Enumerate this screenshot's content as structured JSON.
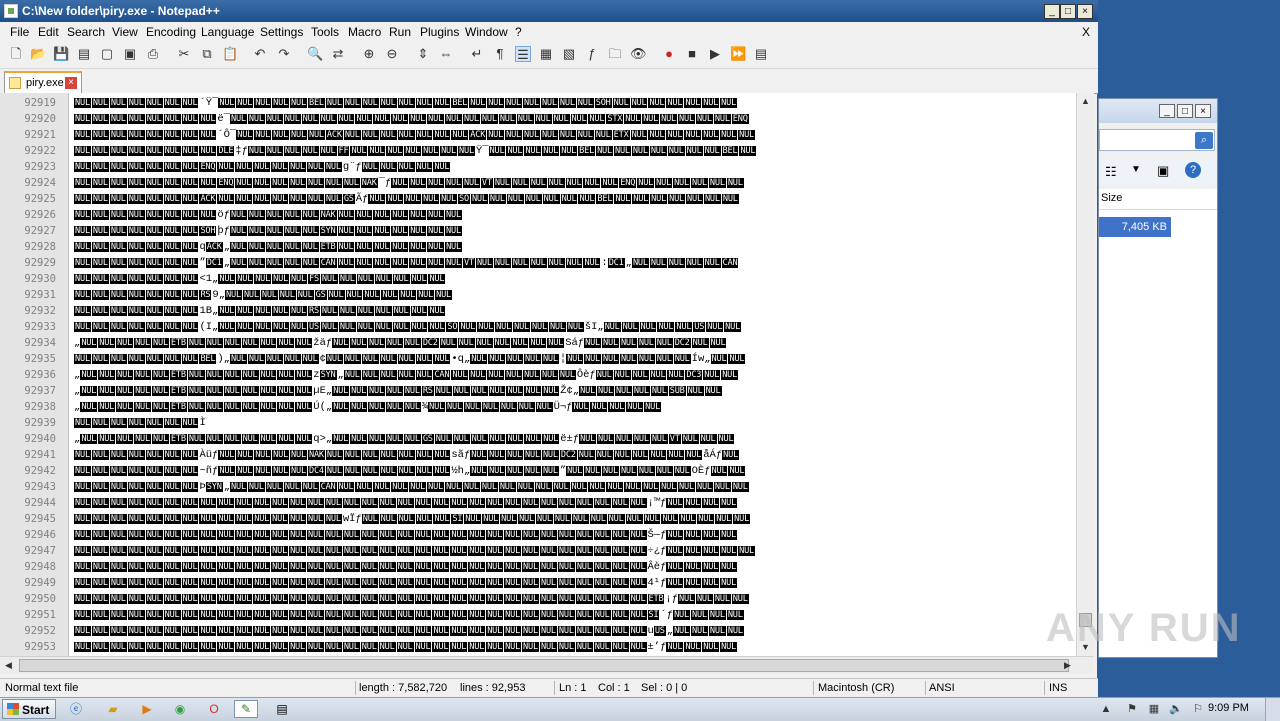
{
  "window": {
    "title": "C:\\New folder\\piry.exe - Notepad++",
    "mdi_close": "X"
  },
  "menu": [
    "File",
    "Edit",
    "Search",
    "View",
    "Encoding",
    "Language",
    "Settings",
    "Tools",
    "Macro",
    "Run",
    "Plugins",
    "Window",
    "?"
  ],
  "tab": {
    "label": "piry.exe"
  },
  "editor": {
    "lines": [
      {
        "n": "92919",
        "t": "NUL NUL NUL NUL NUL NUL NUL ´Ÿ¯ NUL NUL NUL NUL NUL BEL NUL NUL NUL NUL NUL NUL NUL BEL NUL NUL NUL NUL NUL NUL NUL SOH NUL NUL NUL NUL NUL NUL NUL"
      },
      {
        "n": "92920",
        "t": "NUL NUL NUL NUL NUL NUL NUL NUL ë¯ NUL NUL NUL NUL NUL NUL  NUL NUL NUL NUL NUL NUL NUL NUL NUL NUL NUL NUL NUL NUL NUL STX NUL NUL NUL NUL NUL NUL ENQ"
      },
      {
        "n": "92921",
        "t": "NUL NUL NUL NUL NUL NUL NUL NUL ´Ô¯ NUL NUL NUL NUL NUL ACK NUL NUL NUL NUL NUL NUL NUL ACK NUL NUL NUL NUL NUL NUL NUL ETX NUL NUL NUL NUL NUL NUL NUL"
      },
      {
        "n": "92922",
        "t": "NUL NUL NUL NUL NUL NUL NUL NUL DLE ‡ƒ NUL NUL NUL NUL NUL FF NUL NUL NUL NUL NUL NUL NUL  Ÿ¯ NUL NUL NUL NUL NUL BEL NUL NUL NUL NUL NUL NUL NUL BEL NUL"
      },
      {
        "n": "92923",
        "t": "NUL NUL NUL NUL NUL NUL NUL ENQ NUL NUL NUL NUL NUL NUL NUL g¨ƒ NUL NUL NUL NUL NUL"
      },
      {
        "n": "92924",
        "t": "NUL NUL NUL NUL NUL NUL NUL NUL ENQ NUL NUL NUL NUL NUL NUL NUL NAK¯ƒ NUL NUL NUL NUL NUL VT NUL NUL NUL NUL NUL NUL NUL ENQ NUL NUL NUL NUL NUL NUL"
      },
      {
        "n": "92925",
        "t": "NUL NUL NUL NUL NUL NUL NUL ACK NUL NUL NUL NUL NUL NUL NUL GS Ãƒ NUL NUL NUL NUL NUL SO NUL NUL NUL NUL NUL NUL NUL BEL NUL NUL NUL NUL NUL NUL NUL"
      },
      {
        "n": "92926",
        "t": "NUL NUL NUL NUL NUL NUL NUL NUL öƒ NUL NUL NUL NUL NUL NAK NUL NUL NUL NUL NUL NUL NUL"
      },
      {
        "n": "92927",
        "t": "NUL NUL NUL NUL NUL NUL NUL SOH þƒ NUL NUL NUL NUL NUL SYN NUL NUL NUL NUL NUL NUL NUL"
      },
      {
        "n": "92928",
        "t": "NUL NUL NUL NUL NUL NUL NUL qACK„ NUL NUL NUL NUL NUL ETB NUL NUL NUL NUL NUL NUL NUL"
      },
      {
        "n": "92929",
        "t": "NUL NUL NUL NUL NUL NUL NUL ”DC1„ NUL NUL NUL NUL NUL CAN NUL NUL NUL NUL NUL NUL NUL VT NUL NUL NUL NUL NUL NUL NUL :DC1„ NUL NUL NUL NUL NUL CAN"
      },
      {
        "n": "92930",
        "t": "NUL NUL NUL NUL NUL NUL NUL <1„ NUL NUL NUL NUL NUL FS NUL NUL NUL NUL NUL NUL NUL"
      },
      {
        "n": "92931",
        "t": "NUL NUL NUL NUL NUL NUL NUL RS9„ NUL NUL NUL NUL NUL GS NUL NUL NUL NUL NUL NUL NUL"
      },
      {
        "n": "92932",
        "t": "NUL NUL NUL NUL NUL NUL NUL 1B„ NUL NUL NUL NUL NUL RS NUL NUL NUL NUL NUL NUL NUL"
      },
      {
        "n": "92933",
        "t": "NUL NUL NUL NUL NUL NUL NUL (I„ NUL NUL NUL NUL NUL US NUL NUL NUL NUL NUL NUL NUL SO NUL NUL NUL NUL NUL NUL NUL šI„ NUL NUL NUL NUL NUL US NUL NUL"
      },
      {
        "n": "92934",
        "t": "„ NUL NUL NUL NUL NUL ETB NUL NUL NUL NUL NUL NUL NUL žäƒ NUL NUL NUL NUL NUL DC2 NUL NUL NUL NUL NUL NUL NUL Sáƒ NUL NUL NUL NUL NUL DC2 NUL NUL"
      },
      {
        "n": "92935",
        "t": "NUL NUL NUL NUL NUL NUL NUL BEL) „ NUL NUL NUL NUL NUL ¢ NUL NUL NUL NUL NUL NUL NUL •q„ NUL NUL NUL NUL NUL ¦ NUL NUL NUL NUL NUL NUL NUL Íw„ NUL NUL"
      },
      {
        "n": "92936",
        "t": "„ NUL NUL NUL NUL NUL ETB NUL NUL NUL NUL NUL NUL NUL zSYN„ NUL NUL NUL NUL NUL CAN NUL NUL NUL NUL NUL NUL NUL Ôèƒ NUL NUL NUL NUL NUL DC3 NUL NUL"
      },
      {
        "n": "92937",
        "t": "„ NUL NUL NUL NUL NUL ETB NUL NUL NUL NUL NUL NUL NUL µE„ NUL NUL NUL NUL NUL RS NUL NUL NUL NUL NUL NUL NUL Ž¢„ NUL NUL NUL NUL NUL SUB NUL NUL"
      },
      {
        "n": "92938",
        "t": "„ NUL NUL NUL NUL NUL ETB NUL NUL NUL NUL NUL NUL NUL Ú(„ NUL NUL NUL NUL NUL ¾ NUL NUL NUL NUL NUL NUL NUL Ü¬ƒ NUL NUL NUL NUL NUL"
      },
      {
        "n": "92939",
        "t": "NUL NUL NUL NUL NUL NUL NUL Ì"
      },
      {
        "n": "92940",
        "t": "„ NUL NUL NUL NUL NUL ETB NUL NUL NUL NUL NUL NUL NUL q>„ NUL NUL NUL NUL NUL GS NUL NUL NUL NUL NUL NUL NUL ë±ƒ NUL NUL NUL NUL NUL VT NUL NUL NUL"
      },
      {
        "n": "92941",
        "t": "NUL NUL NUL NUL NUL NUL NUL Àüƒ NUL NUL NUL NUL NUL NAK NUL NUL NUL NUL NUL NUL NUL sãƒ NUL NUL NUL NUL NUL DC2 NUL NUL NUL NUL NUL NUL NUL åÁƒ NUL"
      },
      {
        "n": "92942",
        "t": "NUL NUL NUL NUL NUL NUL NUL ~ñƒ NUL NUL NUL NUL NUL DC4 NUL NUL NUL NUL NUL NUL NUL ½h„ NUL NUL NUL NUL NUL ” NUL NUL NUL NUL NUL NUL NUL OÈƒ NUL NUL"
      },
      {
        "n": "92943",
        "t": "NUL NUL NUL NUL NUL NUL NUL Þ SYN„ NUL NUL NUL NUL NUL CAN NUL NUL NUL NUL NUL NUL NUL NUL NUL NUL NUL NUL NUL NUL NUL NUL NUL NUL NUL NUL NUL NUL NUL"
      },
      {
        "n": "92944",
        "t": "NUL NUL NUL NUL NUL NUL NUL NUL NUL NUL NUL NUL NUL NUL NUL NUL NUL NUL NUL NUL NUL NUL NUL NUL NUL NUL NUL NUL NUL NUL NUL NUL ¡™ƒ NUL NUL NUL NUL"
      },
      {
        "n": "92945",
        "t": "NUL NUL NUL NUL NUL NUL NUL NUL NUL NUL NUL NUL NUL NUL NUL wÏƒ NUL NUL NUL NUL NUL SI NUL NUL NUL NUL NUL NUL NUL NUL NUL NUL NUL NUL NUL NUL NUL NUL"
      },
      {
        "n": "92946",
        "t": "NUL NUL NUL NUL NUL NUL NUL NUL NUL NUL NUL NUL NUL NUL NUL NUL NUL NUL NUL NUL NUL NUL NUL NUL NUL NUL NUL NUL NUL NUL NUL NUL Š—ƒ NUL NUL NUL NUL"
      },
      {
        "n": "92947",
        "t": "NUL NUL NUL NUL NUL NUL NUL NUL NUL NUL NUL NUL NUL NUL NUL NUL NUL NUL NUL NUL NUL NUL NUL NUL NUL NUL NUL NUL NUL NUL NUL NUL ÷¿ƒ NUL NUL NUL NUL NUL"
      },
      {
        "n": "92948",
        "t": "NUL NUL NUL NUL NUL NUL NUL NUL NUL NUL NUL NUL NUL NUL NUL NUL NUL NUL NUL NUL NUL NUL NUL NUL NUL NUL NUL NUL NUL NUL NUL NUL Âèƒ NUL NUL NUL NUL"
      },
      {
        "n": "92949",
        "t": "NUL NUL NUL NUL NUL NUL NUL NUL NUL NUL NUL NUL NUL NUL NUL NUL NUL NUL NUL NUL NUL NUL NUL NUL NUL NUL NUL NUL NUL NUL NUL NUL 4¹ƒ NUL NUL NUL NUL"
      },
      {
        "n": "92950",
        "t": "NUL NUL NUL NUL NUL NUL NUL NUL NUL NUL NUL NUL NUL NUL NUL NUL NUL NUL NUL NUL NUL NUL NUL NUL NUL NUL NUL NUL NUL NUL NUL NUL ETB¡ƒ NUL NUL NUL NUL"
      },
      {
        "n": "92951",
        "t": "NUL NUL NUL NUL NUL NUL NUL NUL NUL NUL NUL NUL NUL NUL NUL NUL NUL NUL NUL NUL NUL NUL NUL NUL NUL NUL NUL NUL NUL NUL NUL NUL SI´ƒ NUL NUL NUL NUL"
      },
      {
        "n": "92952",
        "t": "NUL NUL NUL NUL NUL NUL NUL NUL NUL NUL NUL NUL NUL NUL NUL NUL NUL NUL NUL NUL NUL NUL NUL NUL NUL NUL NUL NUL NUL NUL NUL NUL uUS„ NUL NUL NUL NUL"
      },
      {
        "n": "92953",
        "t": "NUL NUL NUL NUL NUL NUL NUL NUL NUL NUL NUL NUL NUL NUL NUL NUL NUL NUL NUL NUL NUL NUL NUL NUL NUL NUL NUL NUL NUL NUL NUL NUL ±’ƒ NUL NUL NUL NUL"
      }
    ]
  },
  "statusbar": {
    "filetype": "Normal text file",
    "length": "length : 7,582,720",
    "lines": "lines : 92,953",
    "ln": "Ln : 1",
    "col": "Col : 1",
    "sel": "Sel : 0 | 0",
    "eol": "Macintosh (CR)",
    "encoding": "ANSI",
    "mode": "INS"
  },
  "explorer": {
    "col_size": "Size",
    "file_size": "7,405 KB"
  },
  "taskbar": {
    "start_label": "Start",
    "clock": "9:09 PM"
  },
  "watermark": "ANY RUN",
  "colors": {
    "titlebar": "#1f4f8a",
    "desktop": "#2a5d99",
    "selection": "#3e73c9",
    "tab_accent": "#f2a23b"
  }
}
